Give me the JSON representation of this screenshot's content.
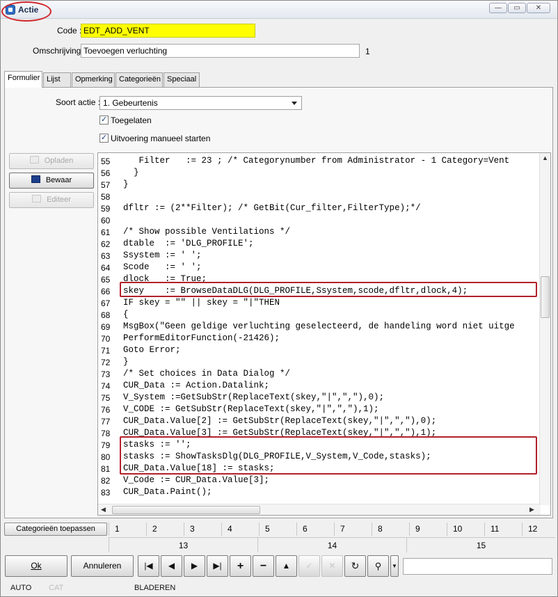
{
  "window": {
    "title": "Actie",
    "minimize": "—",
    "maximize": "▭",
    "close": "✕"
  },
  "form": {
    "code_label": "Code :",
    "code_value": "EDT_ADD_VENT",
    "omschrijving_label": "Omschrijving :",
    "omschrijving_value": "Toevoegen verluchting",
    "omschrijving_index": "1"
  },
  "tabs": [
    "Formulier",
    "Lijst",
    "Opmerking",
    "Categorieën",
    "Speciaal"
  ],
  "formulier": {
    "soort_label": "Soort actie :",
    "soort_value": "1. Gebeurtenis",
    "toegelaten_label": "Toegelaten",
    "toegelaten_checked": true,
    "manueel_label": "Uitvoering manueel starten",
    "manueel_checked": true
  },
  "side_buttons": {
    "opladen": "Opladen",
    "bewaar": "Bewaar",
    "editeer": "Editeer"
  },
  "code_lines": [
    {
      "n": "55",
      "t": "   Filter   := 23 ; /* Categorynumber from Administrator - 1 Category=Vent"
    },
    {
      "n": "56",
      "t": "  }"
    },
    {
      "n": "57",
      "t": "}"
    },
    {
      "n": "58",
      "t": ""
    },
    {
      "n": "59",
      "t": "dfltr := (2**Filter); /* GetBit(Cur_filter,FilterType);*/"
    },
    {
      "n": "60",
      "t": ""
    },
    {
      "n": "61",
      "t": "/* Show possible Ventilations */"
    },
    {
      "n": "62",
      "t": "dtable  := 'DLG_PROFILE';"
    },
    {
      "n": "63",
      "t": "Ssystem := ' ';"
    },
    {
      "n": "64",
      "t": "Scode   := ' ';"
    },
    {
      "n": "65",
      "t": "dlock   := True;"
    },
    {
      "n": "66",
      "t": "skey    := BrowseDataDLG(DLG_PROFILE,Ssystem,scode,dfltr,dlock,4);"
    },
    {
      "n": "67",
      "t": "IF skey = \"\" || skey = \"|\"THEN"
    },
    {
      "n": "68",
      "t": "{"
    },
    {
      "n": "69",
      "t": "MsgBox(\"Geen geldige verluchting geselecteerd, de handeling word niet uitge"
    },
    {
      "n": "70",
      "t": "PerformEditorFunction(-21426);"
    },
    {
      "n": "71",
      "t": "Goto Error;"
    },
    {
      "n": "72",
      "t": "}"
    },
    {
      "n": "73",
      "t": "/* Set choices in Data Dialog */"
    },
    {
      "n": "74",
      "t": "CUR_Data := Action.Datalink;"
    },
    {
      "n": "75",
      "t": "V_System :=GetSubStr(ReplaceText(skey,\"|\",\",\"),0);"
    },
    {
      "n": "76",
      "t": "V_CODE := GetSubStr(ReplaceText(skey,\"|\",\",\"),1);"
    },
    {
      "n": "77",
      "t": "CUR_Data.Value[2] := GetSubStr(ReplaceText(skey,\"|\",\",\"),0);"
    },
    {
      "n": "78",
      "t": "CUR_Data.Value[3] := GetSubStr(ReplaceText(skey,\"|\",\",\"),1);"
    },
    {
      "n": "79",
      "t": "stasks := '';"
    },
    {
      "n": "80",
      "t": "stasks := ShowTasksDlg(DLG_PROFILE,V_System,V_Code,stasks);"
    },
    {
      "n": "81",
      "t": "CUR_Data.Value[18] := stasks;"
    },
    {
      "n": "82",
      "t": "V_Code := CUR_Data.Value[3];"
    },
    {
      "n": "83",
      "t": "CUR_Data.Paint();"
    }
  ],
  "categories": {
    "apply_label": "Categorieën toepassen",
    "row1": [
      "1",
      "2",
      "3",
      "4",
      "5",
      "6",
      "7",
      "8",
      "9",
      "10",
      "11",
      "12"
    ],
    "row2": [
      "13",
      "14",
      "15"
    ]
  },
  "buttons": {
    "ok": "Ok",
    "annuleren": "Annuleren"
  },
  "nav_icons": [
    "first-record-icon",
    "previous-record-icon",
    "next-record-icon",
    "last-record-icon",
    "add-icon",
    "delete-icon",
    "up-icon",
    "confirm-icon",
    "cancel-icon",
    "refresh-icon",
    "search-icon"
  ],
  "status": {
    "mode": "AUTO",
    "cat": "CAT",
    "bladeren": "BLADEREN"
  },
  "colors": {
    "highlight_yellow": "#ffff00",
    "callout_red": "#b3202a"
  }
}
